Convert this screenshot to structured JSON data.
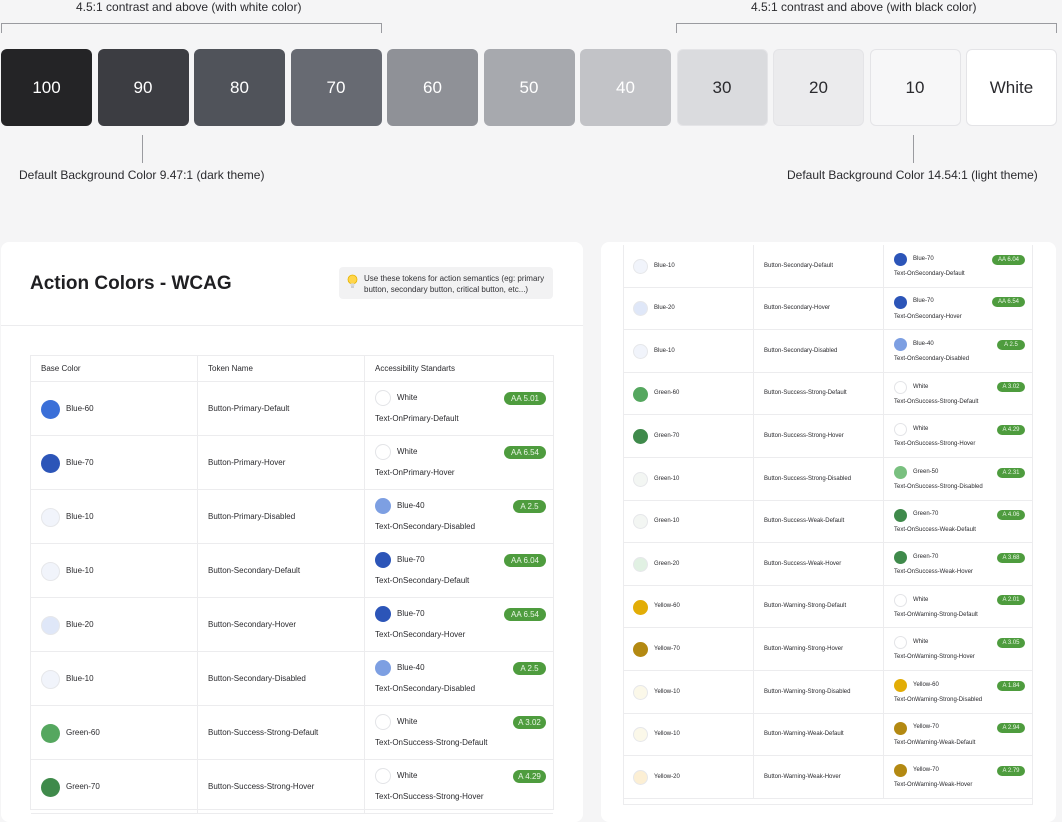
{
  "captions": {
    "white_range": "4.5:1 contrast and above (with white color)",
    "black_range": "4.5:1 contrast and above (with black color)",
    "dark_default": "Default Background Color 9.47:1 (dark theme)",
    "light_default": "Default Background Color 14.54:1 (light theme)"
  },
  "swatches": [
    {
      "label": "100",
      "bg": "#242426",
      "fg": "#ffffff"
    },
    {
      "label": "90",
      "bg": "#3c3d42",
      "fg": "#ffffff"
    },
    {
      "label": "80",
      "bg": "#50535a",
      "fg": "#ffffff"
    },
    {
      "label": "70",
      "bg": "#676a72",
      "fg": "#ffffff"
    },
    {
      "label": "60",
      "bg": "#8f9197",
      "fg": "#ffffff"
    },
    {
      "label": "50",
      "bg": "#a7a9ae",
      "fg": "#ffffff"
    },
    {
      "label": "40",
      "bg": "#c2c3c7",
      "fg": "#ffffff"
    },
    {
      "label": "30",
      "bg": "#dadbde",
      "fg": "#2a2a2e"
    },
    {
      "label": "20",
      "bg": "#ebebed",
      "fg": "#2a2a2e"
    },
    {
      "label": "10",
      "bg": "#f7f7f8",
      "fg": "#2a2a2e"
    },
    {
      "label": "White",
      "bg": "#ffffff",
      "fg": "#2a2a2e"
    }
  ],
  "action_card": {
    "title": "Action Colors - WCAG",
    "tip": "Use these tokens for action semantics (eg: primary button, secondary button, critical button, etc...)",
    "headers": [
      "Base Color",
      "Token Name",
      "Accessibility Standarts"
    ]
  },
  "colors": {
    "Blue-60": "#3a6fd8",
    "Blue-70": "#2c55b8",
    "Blue-10": "#f1f4fb",
    "Blue-20": "#dfe7f8",
    "Blue-40": "#7d9fe2",
    "Green-60": "#55a75f",
    "Green-70": "#3f8a4b",
    "Green-10": "#f3f6f3",
    "Green-20": "#e1f1e3",
    "Green-50": "#79c07f",
    "Yellow-60": "#e2ad06",
    "Yellow-70": "#b38912",
    "Yellow-10": "#fbf8e9",
    "Yellow-20": "#fcefd4",
    "White": "#ffffff"
  },
  "left_rows": [
    {
      "base": "Blue-60",
      "token": "Button-Primary-Default",
      "text_color": "White",
      "badge": "AA 5.01",
      "role": "Text-OnPrimary-Default"
    },
    {
      "base": "Blue-70",
      "token": "Button-Primary-Hover",
      "text_color": "White",
      "badge": "AA 6.54",
      "role": "Text-OnPrimary-Hover"
    },
    {
      "base": "Blue-10",
      "token": "Button-Primary-Disabled",
      "text_color": "Blue-40",
      "badge": "A 2.5",
      "role": "Text-OnSecondary-Disabled"
    },
    {
      "base": "Blue-10",
      "token": "Button-Secondary-Default",
      "text_color": "Blue-70",
      "badge": "AA 6.04",
      "role": "Text-OnSecondary-Default"
    },
    {
      "base": "Blue-20",
      "token": "Button-Secondary-Hover",
      "text_color": "Blue-70",
      "badge": "AA 6.54",
      "role": "Text-OnSecondary-Hover"
    },
    {
      "base": "Blue-10",
      "token": "Button-Secondary-Disabled",
      "text_color": "Blue-40",
      "badge": "A 2.5",
      "role": "Text-OnSecondary-Disabled"
    },
    {
      "base": "Green-60",
      "token": "Button-Success-Strong-Default",
      "text_color": "White",
      "badge": "A 3.02",
      "role": "Text-OnSuccess-Strong-Default"
    },
    {
      "base": "Green-70",
      "token": "Button-Success-Strong-Hover",
      "text_color": "White",
      "badge": "A 4.29",
      "role": "Text-OnSuccess-Strong-Hover"
    }
  ],
  "right_rows": [
    {
      "base": "Blue-10",
      "token": "Button-Secondary-Default",
      "text_color": "Blue-70",
      "badge": "AA 6.04",
      "role": "Text-OnSecondary-Default"
    },
    {
      "base": "Blue-20",
      "token": "Button-Secondary-Hover",
      "text_color": "Blue-70",
      "badge": "AA 6.54",
      "role": "Text-OnSecondary-Hover"
    },
    {
      "base": "Blue-10",
      "token": "Button-Secondary-Disabled",
      "text_color": "Blue-40",
      "badge": "A 2.5",
      "role": "Text-OnSecondary-Disabled"
    },
    {
      "base": "Green-60",
      "token": "Button-Success-Strong-Default",
      "text_color": "White",
      "badge": "A 3.02",
      "role": "Text-OnSuccess-Strong-Default"
    },
    {
      "base": "Green-70",
      "token": "Button-Success-Strong-Hover",
      "text_color": "White",
      "badge": "A 4.29",
      "role": "Text-OnSuccess-Strong-Hover"
    },
    {
      "base": "Green-10",
      "token": "Button-Success-Strong-Disabled",
      "text_color": "Green-50",
      "badge": "A 2.31",
      "role": "Text-OnSuccess-Strong-Disabled"
    },
    {
      "base": "Green-10",
      "token": "Button-Success-Weak-Default",
      "text_color": "Green-70",
      "badge": "A 4.06",
      "role": "Text-OnSuccess-Weak-Default"
    },
    {
      "base": "Green-20",
      "token": "Button-Success-Weak-Hover",
      "text_color": "Green-70",
      "badge": "A 3.68",
      "role": "Text-OnSuccess-Weak-Hover"
    },
    {
      "base": "Yellow-60",
      "token": "Button-Warning-Strong-Default",
      "text_color": "White",
      "badge": "A 2.01",
      "role": "Text-OnWarning-Strong-Default"
    },
    {
      "base": "Yellow-70",
      "token": "Button-Warning-Strong-Hover",
      "text_color": "White",
      "badge": "A 3.05",
      "role": "Text-OnWarning-Strong-Hover"
    },
    {
      "base": "Yellow-10",
      "token": "Button-Warning-Strong-Disabled",
      "text_color": "Yellow-60",
      "badge": "A 1.84",
      "role": "Text-OnWarning-Strong-Disabled"
    },
    {
      "base": "Yellow-10",
      "token": "Button-Warning-Weak-Default",
      "text_color": "Yellow-70",
      "badge": "A 2.94",
      "role": "Text-OnWarning-Weak-Default"
    },
    {
      "base": "Yellow-20",
      "token": "Button-Warning-Weak-Hover",
      "text_color": "Yellow-70",
      "badge": "A 2.79",
      "role": "Text-OnWarning-Weak-Hover"
    }
  ]
}
